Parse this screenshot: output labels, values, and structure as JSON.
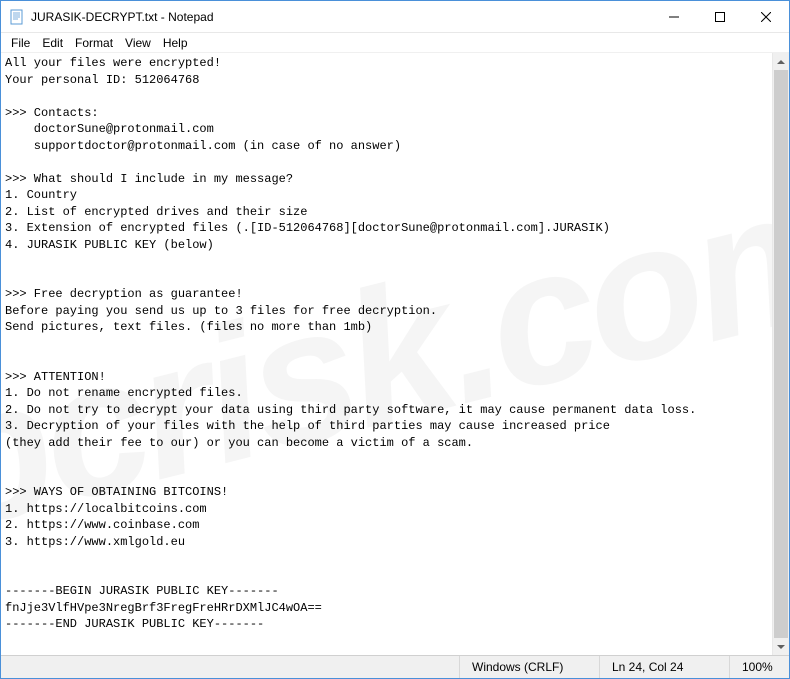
{
  "titlebar": {
    "title": "JURASIK-DECRYPT.txt - Notepad"
  },
  "menubar": {
    "items": [
      {
        "label": "File"
      },
      {
        "label": "Edit"
      },
      {
        "label": "Format"
      },
      {
        "label": "View"
      },
      {
        "label": "Help"
      }
    ]
  },
  "content": {
    "text": "All your files were encrypted!\nYour personal ID: 512064768\n\n>>> Contacts:\n    doctorSune@protonmail.com\n    supportdoctor@protonmail.com (in case of no answer)\n\n>>> What should I include in my message?\n1. Country\n2. List of encrypted drives and their size\n3. Extension of encrypted files (.[ID-512064768][doctorSune@protonmail.com].JURASIK)\n4. JURASIK PUBLIC KEY (below)\n\n\n>>> Free decryption as guarantee!\nBefore paying you send us up to 3 files for free decryption.\nSend pictures, text files. (files no more than 1mb)\n\n\n>>> ATTENTION!\n1. Do not rename encrypted files.\n2. Do not try to decrypt your data using third party software, it may cause permanent data loss.\n3. Decryption of your files with the help of third parties may cause increased price\n(they add their fee to our) or you can become a victim of a scam.\n\n\n>>> WAYS OF OBTAINING BITCOINS!\n1. https://localbitcoins.com\n2. https://www.coinbase.com\n3. https://www.xmlgold.eu\n\n\n-------BEGIN JURASIK PUBLIC KEY-------\nfnJje3VlfHVpe3NregBrf3FregFreHRrDXMlJC4wOA==\n-------END JURASIK PUBLIC KEY-------"
  },
  "statusbar": {
    "encoding": "Windows (CRLF)",
    "position": "Ln 24, Col 24",
    "zoom": "100%"
  },
  "watermark": {
    "text": "pcrisk.com"
  }
}
